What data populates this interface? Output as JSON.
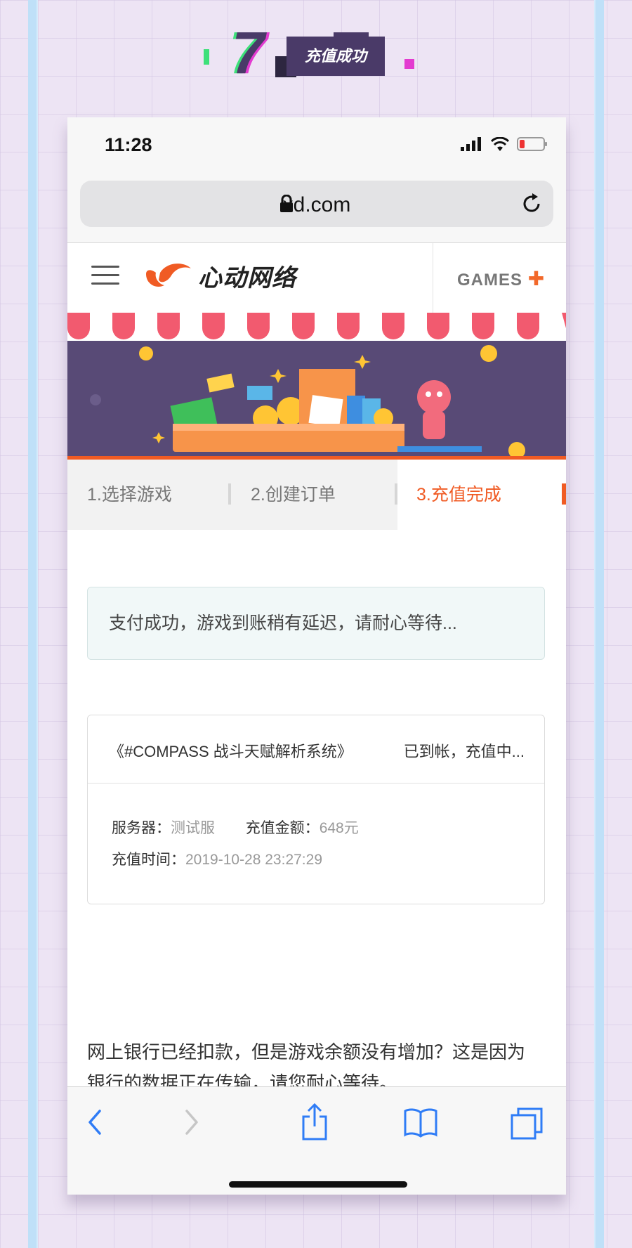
{
  "step": {
    "number": "7",
    "title": "充值成功"
  },
  "statusbar": {
    "time": "11:28"
  },
  "browser": {
    "url": "xd.com"
  },
  "site": {
    "logo_text": "心动网络",
    "games_link": "GAMES"
  },
  "steps": {
    "tabs": [
      {
        "label": "1.选择游戏"
      },
      {
        "label": "2.创建订单"
      },
      {
        "label": "3.充值完成"
      }
    ],
    "active_index": 2
  },
  "notice": {
    "text": "支付成功，游戏到账稍有延迟，请耐心等待..."
  },
  "order": {
    "game": "《#COMPASS 战斗天赋解析系统》",
    "status": "已到帐，充值中...",
    "server_label": "服务器：",
    "server_value": "测试服",
    "amount_label": "充值金额：",
    "amount_value": "648元",
    "time_label": "充值时间：",
    "time_value": "2019-10-28 23:27:29"
  },
  "faq": {
    "line1": "网上银行已经扣款，但是游戏余额没有增加？这是因为",
    "line2": "银行的数据正在传输，请您耐心等待。"
  },
  "colors": {
    "accent": "#f05b24",
    "banner_bg": "#584a76",
    "badge_bg": "#4a3a68"
  }
}
